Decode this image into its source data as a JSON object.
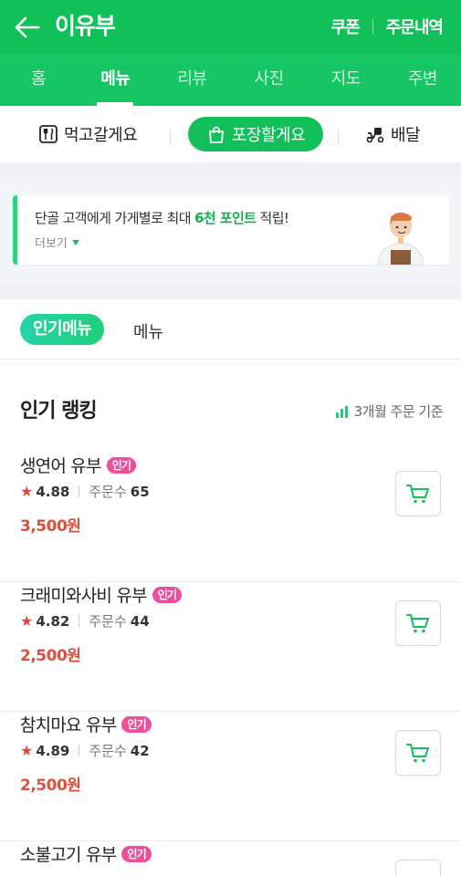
{
  "header": {
    "title": "이유부",
    "coupon_label": "쿠폰",
    "orders_label": "주문내역"
  },
  "tabs": [
    {
      "label": "홈"
    },
    {
      "label": "메뉴"
    },
    {
      "label": "리뷰"
    },
    {
      "label": "사진"
    },
    {
      "label": "지도"
    },
    {
      "label": "주변"
    }
  ],
  "order_types": {
    "eat_in": "먹고갈게요",
    "takeout": "포장할게요",
    "delivery": "배달"
  },
  "promo": {
    "text_before": "단골 고객에게 가게별로 최대 ",
    "highlight": "6천 포인트",
    "text_after": " 적립!",
    "more_label": "더보기"
  },
  "segment": {
    "popular_label": "인기메뉴",
    "menu_label": "메뉴"
  },
  "ranking": {
    "title": "인기 랭킹",
    "basis": "3개월 주문 기준"
  },
  "items": [
    {
      "name": "생연어 유부",
      "badge": "인기",
      "rating": "4.88",
      "order_label": "주문수",
      "order_count": "65",
      "price": "3,500원"
    },
    {
      "name": "크래미와사비 유부",
      "badge": "인기",
      "rating": "4.82",
      "order_label": "주문수",
      "order_count": "44",
      "price": "2,500원"
    },
    {
      "name": "참치마요 유부",
      "badge": "인기",
      "rating": "4.89",
      "order_label": "주문수",
      "order_count": "42",
      "price": "2,500원"
    },
    {
      "name": "소불고기 유부",
      "badge": "인기",
      "rating": "",
      "order_label": "",
      "order_count": "",
      "price": ""
    }
  ],
  "colors": {
    "brand_green": "#12c05a",
    "price_red": "#e24d3a",
    "badge_pink": "#ee4f9a"
  }
}
